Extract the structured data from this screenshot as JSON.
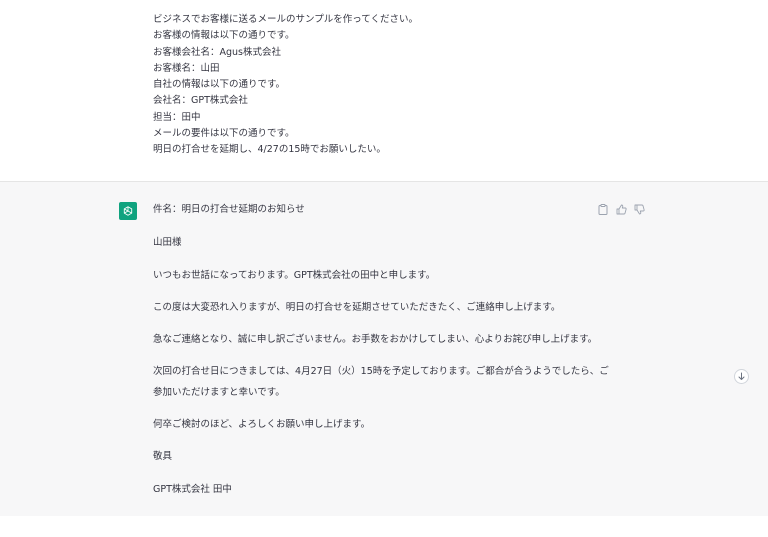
{
  "user_message": {
    "lines": [
      "ビジネスでお客様に送るメールのサンプルを作ってください。",
      "お客様の情報は以下の通りです。",
      "お客様会社名：Agus株式会社",
      "お客様名：山田",
      "自社の情報は以下の通りです。",
      "会社名：GPT株式会社",
      "担当：田中",
      "メールの要件は以下の通りです。",
      "明日の打合せを延期し、4/27の15時でお願いしたい。"
    ]
  },
  "assistant_message": {
    "subject": "件名：明日の打合せ延期のお知らせ",
    "salutation": "山田様",
    "paragraph_1": "いつもお世話になっております。GPT株式会社の田中と申します。",
    "paragraph_2": "この度は大変恐れ入りますが、明日の打合せを延期させていただきたく、ご連絡申し上げます。",
    "paragraph_3": "急なご連絡となり、誠に申し訳ございません。お手数をおかけしてしまい、心よりお詫び申し上げます。",
    "paragraph_4_line_1": "次回の打合せ日につきましては、4月27日（火）15時を予定しております。ご都合が合うようでしたら、ご",
    "paragraph_4_line_2": "参加いただけますと幸いです。",
    "paragraph_5": "何卒ご検討のほど、よろしくお願い申し上げます。",
    "closing": "敬具",
    "signature": "GPT株式会社 田中"
  },
  "icons": {
    "avatar": "openai-logo-icon",
    "copy": "clipboard-icon",
    "like": "thumbs-up-icon",
    "dislike": "thumbs-down-icon",
    "scroll": "arrow-down-icon"
  },
  "colors": {
    "accent": "#10a37f",
    "assistant_bg": "#f7f7f8",
    "text": "#343541"
  }
}
